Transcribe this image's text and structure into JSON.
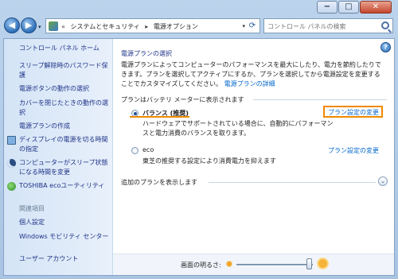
{
  "colors": {
    "accent": "#f08a00",
    "link": "#0066cc",
    "sidebar_link": "#1e3287"
  },
  "window_buttons": {
    "minimize": "−",
    "maximize": "□",
    "close": "✕"
  },
  "nav": {
    "back_glyph": "◀",
    "forward_glyph": "▶",
    "dropdown_glyph": "▾"
  },
  "address": {
    "prefix": "«",
    "segments": [
      "システムとセキュリティ",
      "電源オプション"
    ],
    "separator": "▸",
    "dropdown_glyph": "▾",
    "refresh_glyph": "⟳"
  },
  "search": {
    "placeholder": "コントロール パネルの検索"
  },
  "sidebar": {
    "items": [
      {
        "label": "コントロール パネル ホーム"
      },
      {
        "label": "スリープ解除時のパスワード保護"
      },
      {
        "label": "電源ボタンの動作の選択"
      },
      {
        "label": "カバーを閉じたときの動作の選択"
      },
      {
        "label": "電源プランの作成"
      },
      {
        "label": "ディスプレイの電源を切る時間の指定",
        "icon": "monitor-icon"
      },
      {
        "label": "コンピューターがスリープ状態になる時間を変更",
        "icon": "moon-icon"
      },
      {
        "label": "TOSHIBA ecoユーティリティ",
        "icon": "toshiba-eco-icon"
      }
    ],
    "related_header": "関連項目",
    "related": [
      {
        "label": "個人設定"
      },
      {
        "label": "Windows モビリティ センター"
      },
      {
        "label": "ユーザー アカウント"
      }
    ]
  },
  "main": {
    "help_glyph": "?",
    "title": "電源プランの選択",
    "description": "電源プランによってコンピューターのパフォーマンスを最大にしたり、電力を節約したりできます。プランを選択してアクティブにするか、プランを選択してから電源設定を変更することでカスタマイズしてください。",
    "desc_link": "電源プランの詳細",
    "group_header": "プランはバッテリ メーターに表示されます",
    "plans": [
      {
        "name": "バランス (推奨)",
        "selected": true,
        "description": "ハードウェアでサポートされている場合に、自動的にパフォーマンスと電力消費のバランスを取ります。",
        "change_link": "プラン設定の変更"
      },
      {
        "name": "eco",
        "selected": false,
        "description": "東芝の推奨する設定により消費電力を抑えます",
        "change_link": "プラン設定の変更"
      }
    ],
    "more_plans": "追加のプランを表示します",
    "expand_glyph": "⌄",
    "brightness_label": "画面の明るさ:",
    "brightness_level": 0.95
  }
}
